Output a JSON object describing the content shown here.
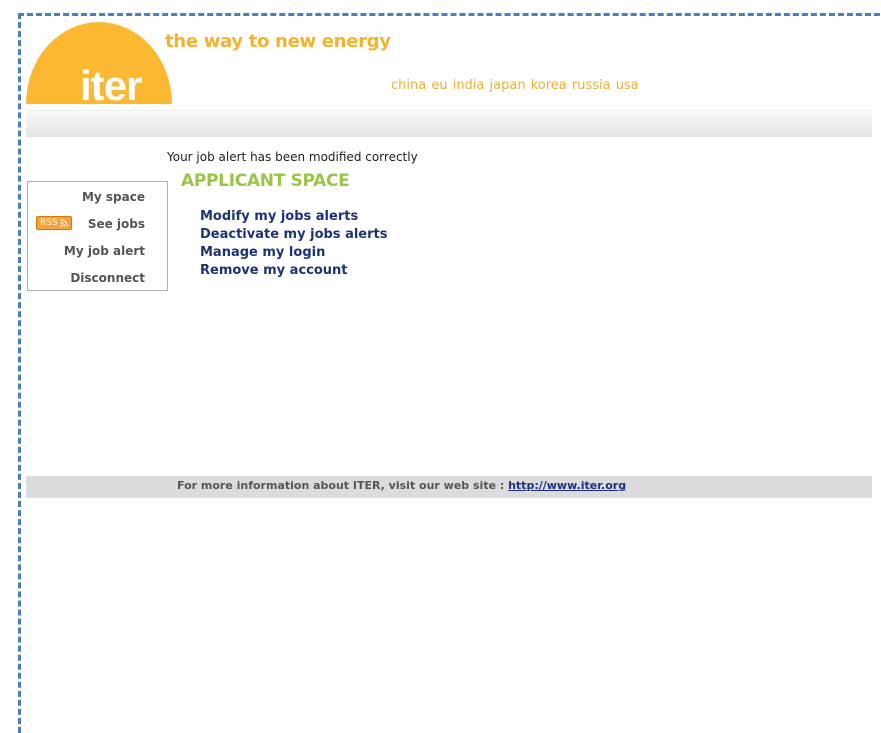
{
  "header": {
    "logo_text": "iter",
    "tagline": "the way to new energy",
    "countries": "china eu india japan korea russia usa"
  },
  "status_message": "Your job alert has been modified correctly",
  "sidebar": {
    "items": [
      {
        "label": "My space"
      },
      {
        "label": "See jobs"
      },
      {
        "label": "My job alert"
      },
      {
        "label": "Disconnect"
      }
    ],
    "rss_label": "RSS"
  },
  "main": {
    "title": "APPLICANT SPACE",
    "links": [
      {
        "label": "Modify my jobs alerts"
      },
      {
        "label": "Deactivate my jobs alerts"
      },
      {
        "label": "Manage my login"
      },
      {
        "label": "Remove my account"
      }
    ]
  },
  "footer": {
    "text": "For more information about ITER, visit our web site : ",
    "link": "http://www.iter.org"
  },
  "colors": {
    "brand_orange": "#fbb830",
    "title_green": "#9ac648",
    "link_blue": "#1e3278",
    "frame_dashed_blue": "#4a7dc4"
  }
}
